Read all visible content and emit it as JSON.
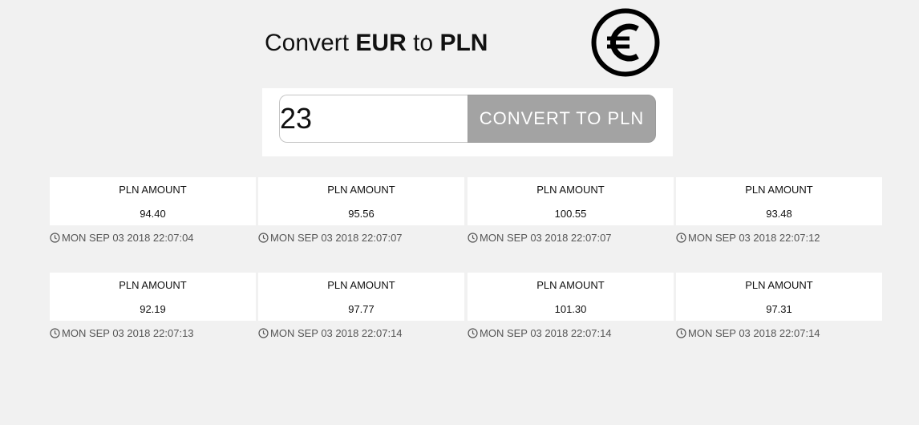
{
  "header": {
    "title_prefix": "Convert ",
    "from_currency": "EUR",
    "title_middle": " to ",
    "to_currency": "PLN",
    "logo_icon": "euro-circle-icon"
  },
  "form": {
    "amount_value": "23",
    "convert_button_label": "CONVERT TO PLN"
  },
  "colors": {
    "background": "#f1f1f1",
    "card": "#ffffff",
    "button": "#a3a3a3"
  },
  "results": [
    {
      "label": "PLN AMOUNT",
      "value": "94.40",
      "timestamp": "MON SEP 03 2018 22:07:04"
    },
    {
      "label": "PLN AMOUNT",
      "value": "95.56",
      "timestamp": "MON SEP 03 2018 22:07:07"
    },
    {
      "label": "PLN AMOUNT",
      "value": "100.55",
      "timestamp": "MON SEP 03 2018 22:07:07"
    },
    {
      "label": "PLN AMOUNT",
      "value": "93.48",
      "timestamp": "MON SEP 03 2018 22:07:12"
    },
    {
      "label": "PLN AMOUNT",
      "value": "92.19",
      "timestamp": "MON SEP 03 2018 22:07:13"
    },
    {
      "label": "PLN AMOUNT",
      "value": "97.77",
      "timestamp": "MON SEP 03 2018 22:07:14"
    },
    {
      "label": "PLN AMOUNT",
      "value": "101.30",
      "timestamp": "MON SEP 03 2018 22:07:14"
    },
    {
      "label": "PLN AMOUNT",
      "value": "97.31",
      "timestamp": "MON SEP 03 2018 22:07:14"
    }
  ]
}
